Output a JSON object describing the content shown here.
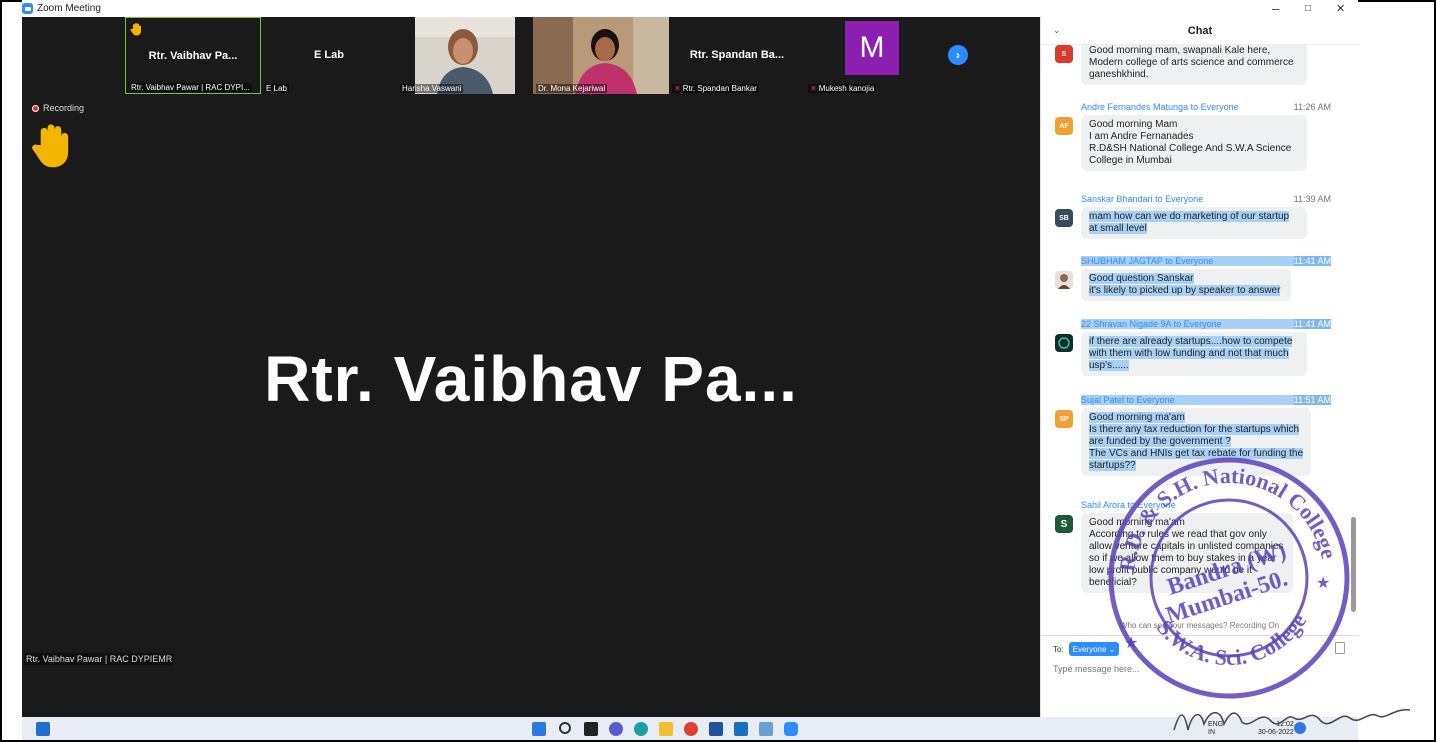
{
  "window": {
    "title": "Zoom Meeting"
  },
  "window_controls": {
    "minimize": "–",
    "maximize": "□",
    "close": "✕"
  },
  "gallery": {
    "tiles": [
      {
        "name": "Rtr. Vaibhav Pa...",
        "caption": "Rtr. Vaibhav Pawar | RAC DYPI..."
      },
      {
        "name": "E Lab",
        "caption": "E Lab"
      },
      {
        "caption": "Harisha Vaswani"
      },
      {
        "caption": "Dr. Mona Kejariwal"
      },
      {
        "name": "Rtr. Spandan Ba...",
        "caption": "Rtr. Spandan Bankar"
      },
      {
        "avatar_letter": "M",
        "caption": "Mukesh kanojia"
      }
    ],
    "next_icon": "chevron-right-icon"
  },
  "recording_label": "Recording",
  "active_speaker": {
    "display_name": "Rtr. Vaibhav Pa...",
    "full_name": "Rtr. Vaibhav Pawar | RAC DYPIEMR"
  },
  "chat": {
    "title": "Chat",
    "messages": [
      {
        "avatar": "S",
        "avatar_color": "#d8392b",
        "text": "Good morning mam, swapnali Kale here,\nModern college of arts science and commerce\nganeshkhind."
      },
      {
        "sender": "Andre Fernandes Matunga",
        "to": "to Everyone",
        "time": "11:26 AM",
        "avatar": "AF",
        "avatar_color": "#f0a030",
        "text": "Good morning Mam\nI am Andre Fernanades\nR.D&SH National College And S.W.A Science\nCollege in Mumbai"
      },
      {
        "sender": "Sanskar Bhandari",
        "to": "to Everyone",
        "time": "11:39 AM",
        "avatar": "SB",
        "avatar_color": "#3a4a5a",
        "text": "mam how  can we do marketing of our startup\nat small level"
      },
      {
        "sender": "SHUBHAM JAGTAP",
        "to": "to Everyone",
        "time": "11:41 AM",
        "avatar_color": "#c8b8a8",
        "text": "Good question Sanskar\nit's likely to picked up by speaker to answer"
      },
      {
        "sender": "22 Shravan Nigade 9A",
        "to": "to Everyone",
        "time": "11:41 AM",
        "avatar_color": "#0e2f2a",
        "text": "if there are already startups....how to compete\nwith them with low funding and not that much\nusp's......"
      },
      {
        "sender": "Sujal Patel",
        "to": "to Everyone",
        "time": "11:51 AM",
        "avatar": "SP",
        "avatar_color": "#f0a030",
        "text": "Good morning ma'am\nIs there any tax reduction for the startups which\nare funded by the government ?\nThe VCs and HNIs get tax rebate for funding the\nstartups??"
      },
      {
        "sender": "Sahil Arora",
        "to": "to Everyone",
        "avatar": "S",
        "avatar_color": "#1d5a3a",
        "text": "Good morning ma'am\nAccording to rules we read that gov only\nallow venture capitals in unlisted companies\nso if we allow them to buy stakes in a year\nlow profit public company would be it\nbeneficial?"
      }
    ],
    "who_can_see": "Who can see your messages? Recording On",
    "to_label": "To:",
    "to_value": "Everyone ⌄",
    "input_placeholder": "Type message here..."
  },
  "taskbar": {
    "language": "ENG",
    "region": "IN",
    "time": "12:02",
    "date": "30-06-2022"
  },
  "stamp": {
    "lines": [
      "R.D. & S.H. National College",
      "S.W.A. Sci. College",
      "Bandra (W)",
      "Mumbai-50."
    ]
  }
}
